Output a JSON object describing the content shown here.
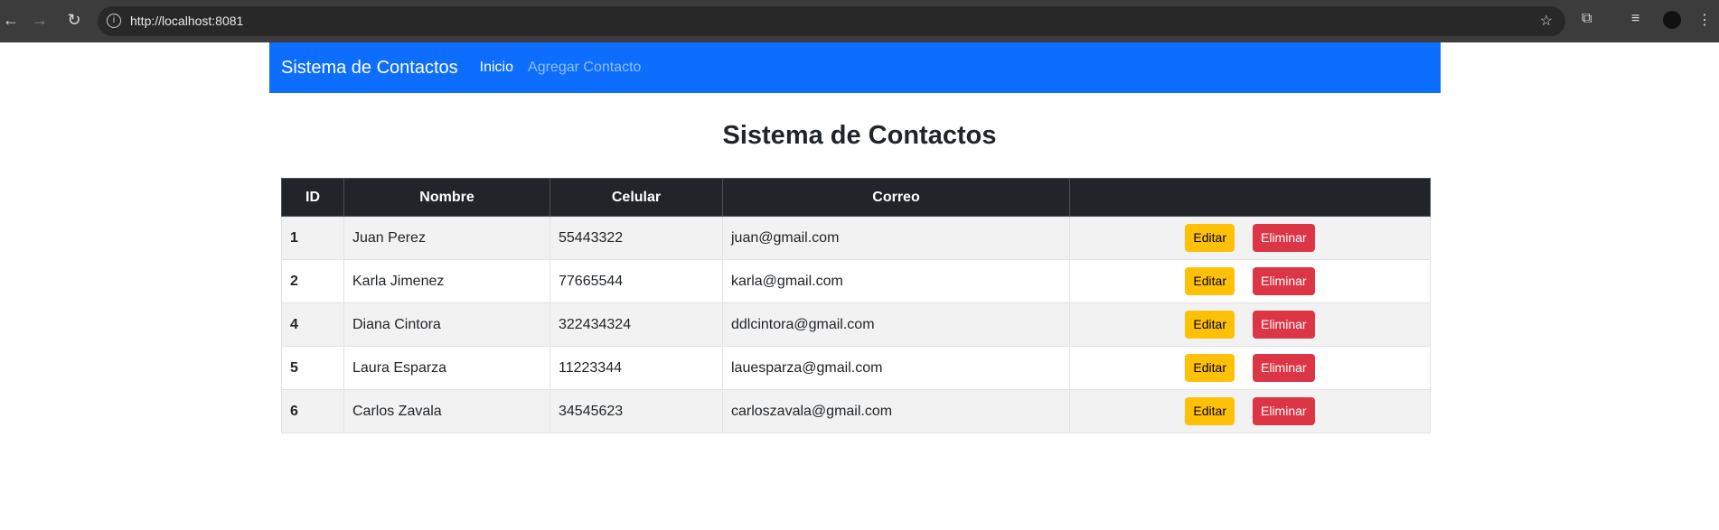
{
  "browser": {
    "url": "http://localhost:8081"
  },
  "navbar": {
    "brand": "Sistema de Contactos",
    "links": [
      {
        "label": "Inicio",
        "active": true
      },
      {
        "label": "Agregar Contacto",
        "active": false
      }
    ]
  },
  "page_title": "Sistema de Contactos",
  "table": {
    "headers": [
      "ID",
      "Nombre",
      "Celular",
      "Correo",
      ""
    ],
    "rows": [
      {
        "id": "1",
        "nombre": "Juan Perez",
        "celular": "55443322",
        "correo": "juan@gmail.com"
      },
      {
        "id": "2",
        "nombre": "Karla Jimenez",
        "celular": "77665544",
        "correo": "karla@gmail.com"
      },
      {
        "id": "4",
        "nombre": "Diana Cintora",
        "celular": "322434324",
        "correo": "ddlcintora@gmail.com"
      },
      {
        "id": "5",
        "nombre": "Laura Esparza",
        "celular": "11223344",
        "correo": "lauesparza@gmail.com"
      },
      {
        "id": "6",
        "nombre": "Carlos Zavala",
        "celular": "34545623",
        "correo": "carloszavala@gmail.com"
      }
    ],
    "edit_label": "Editar",
    "delete_label": "Eliminar"
  },
  "colors": {
    "primary": "#0d6efd",
    "warning": "#ffc107",
    "danger": "#dc3545",
    "dark": "#212529"
  }
}
